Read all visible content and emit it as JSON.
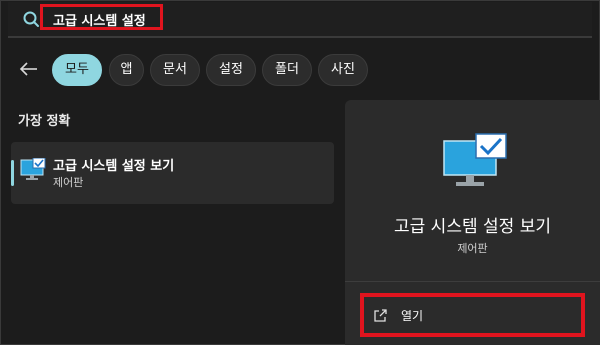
{
  "search": {
    "value": "고급 시스템 설정"
  },
  "filters": [
    {
      "label": "모두",
      "active": true
    },
    {
      "label": "앱",
      "active": false
    },
    {
      "label": "문서",
      "active": false
    },
    {
      "label": "설정",
      "active": false
    },
    {
      "label": "폴더",
      "active": false
    },
    {
      "label": "사진",
      "active": false
    }
  ],
  "results": {
    "section_title": "가장 정확",
    "best_match": {
      "title": "고급 시스템 설정 보기",
      "subtitle": "제어판",
      "icon": "monitor-check-icon"
    }
  },
  "detail": {
    "title": "고급 시스템 설정 보기",
    "subtitle": "제어판",
    "icon": "monitor-check-icon",
    "actions": [
      {
        "label": "열기",
        "icon": "open-external-icon"
      }
    ]
  },
  "colors": {
    "accent": "#8fd6e0",
    "highlight_box": "#e0141e",
    "background": "#1c1c1c",
    "panel": "#2b2b2b"
  }
}
